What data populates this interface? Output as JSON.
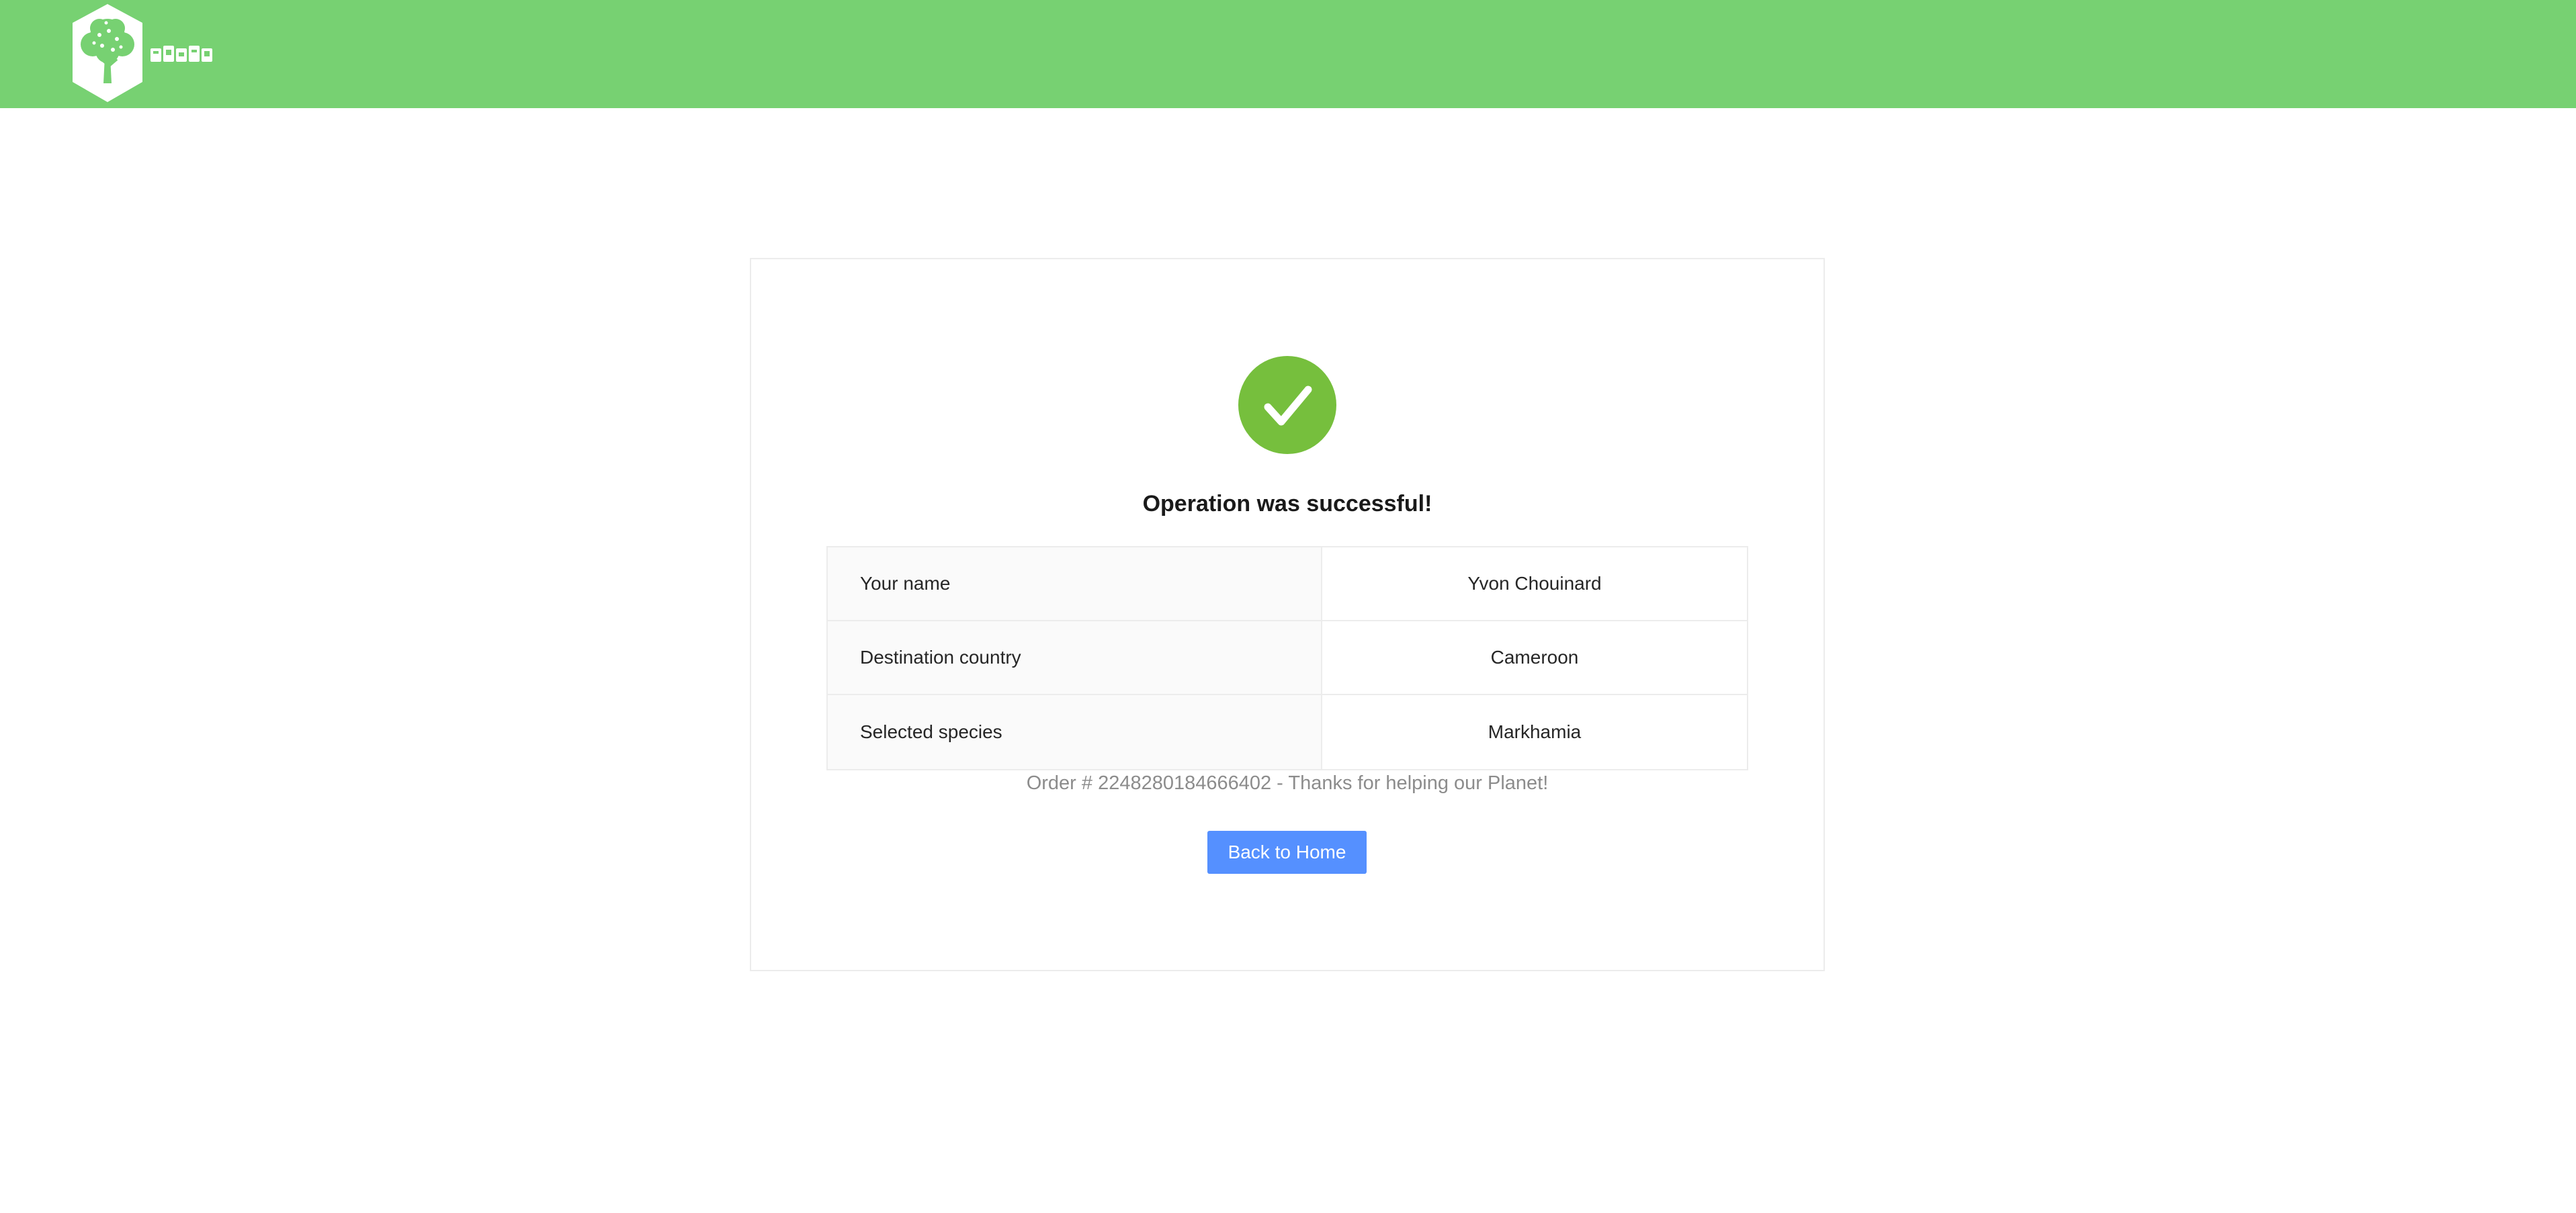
{
  "header": {
    "background_color": "#77d172",
    "logo": {
      "icon": "tree-logo-icon"
    }
  },
  "result": {
    "icon": "check-circle-icon",
    "icon_color": "#76bf3d",
    "title": "Operation was successful!",
    "details": [
      {
        "label": "Your name",
        "value": "Yvon Chouinard"
      },
      {
        "label": "Destination country",
        "value": "Cameroon"
      },
      {
        "label": "Selected species",
        "value": "Markhamia"
      }
    ],
    "order_note": "Order # 2248280184666402 - Thanks for helping our Planet!",
    "back_button_label": "Back to Home",
    "button_color": "#5590ff"
  }
}
